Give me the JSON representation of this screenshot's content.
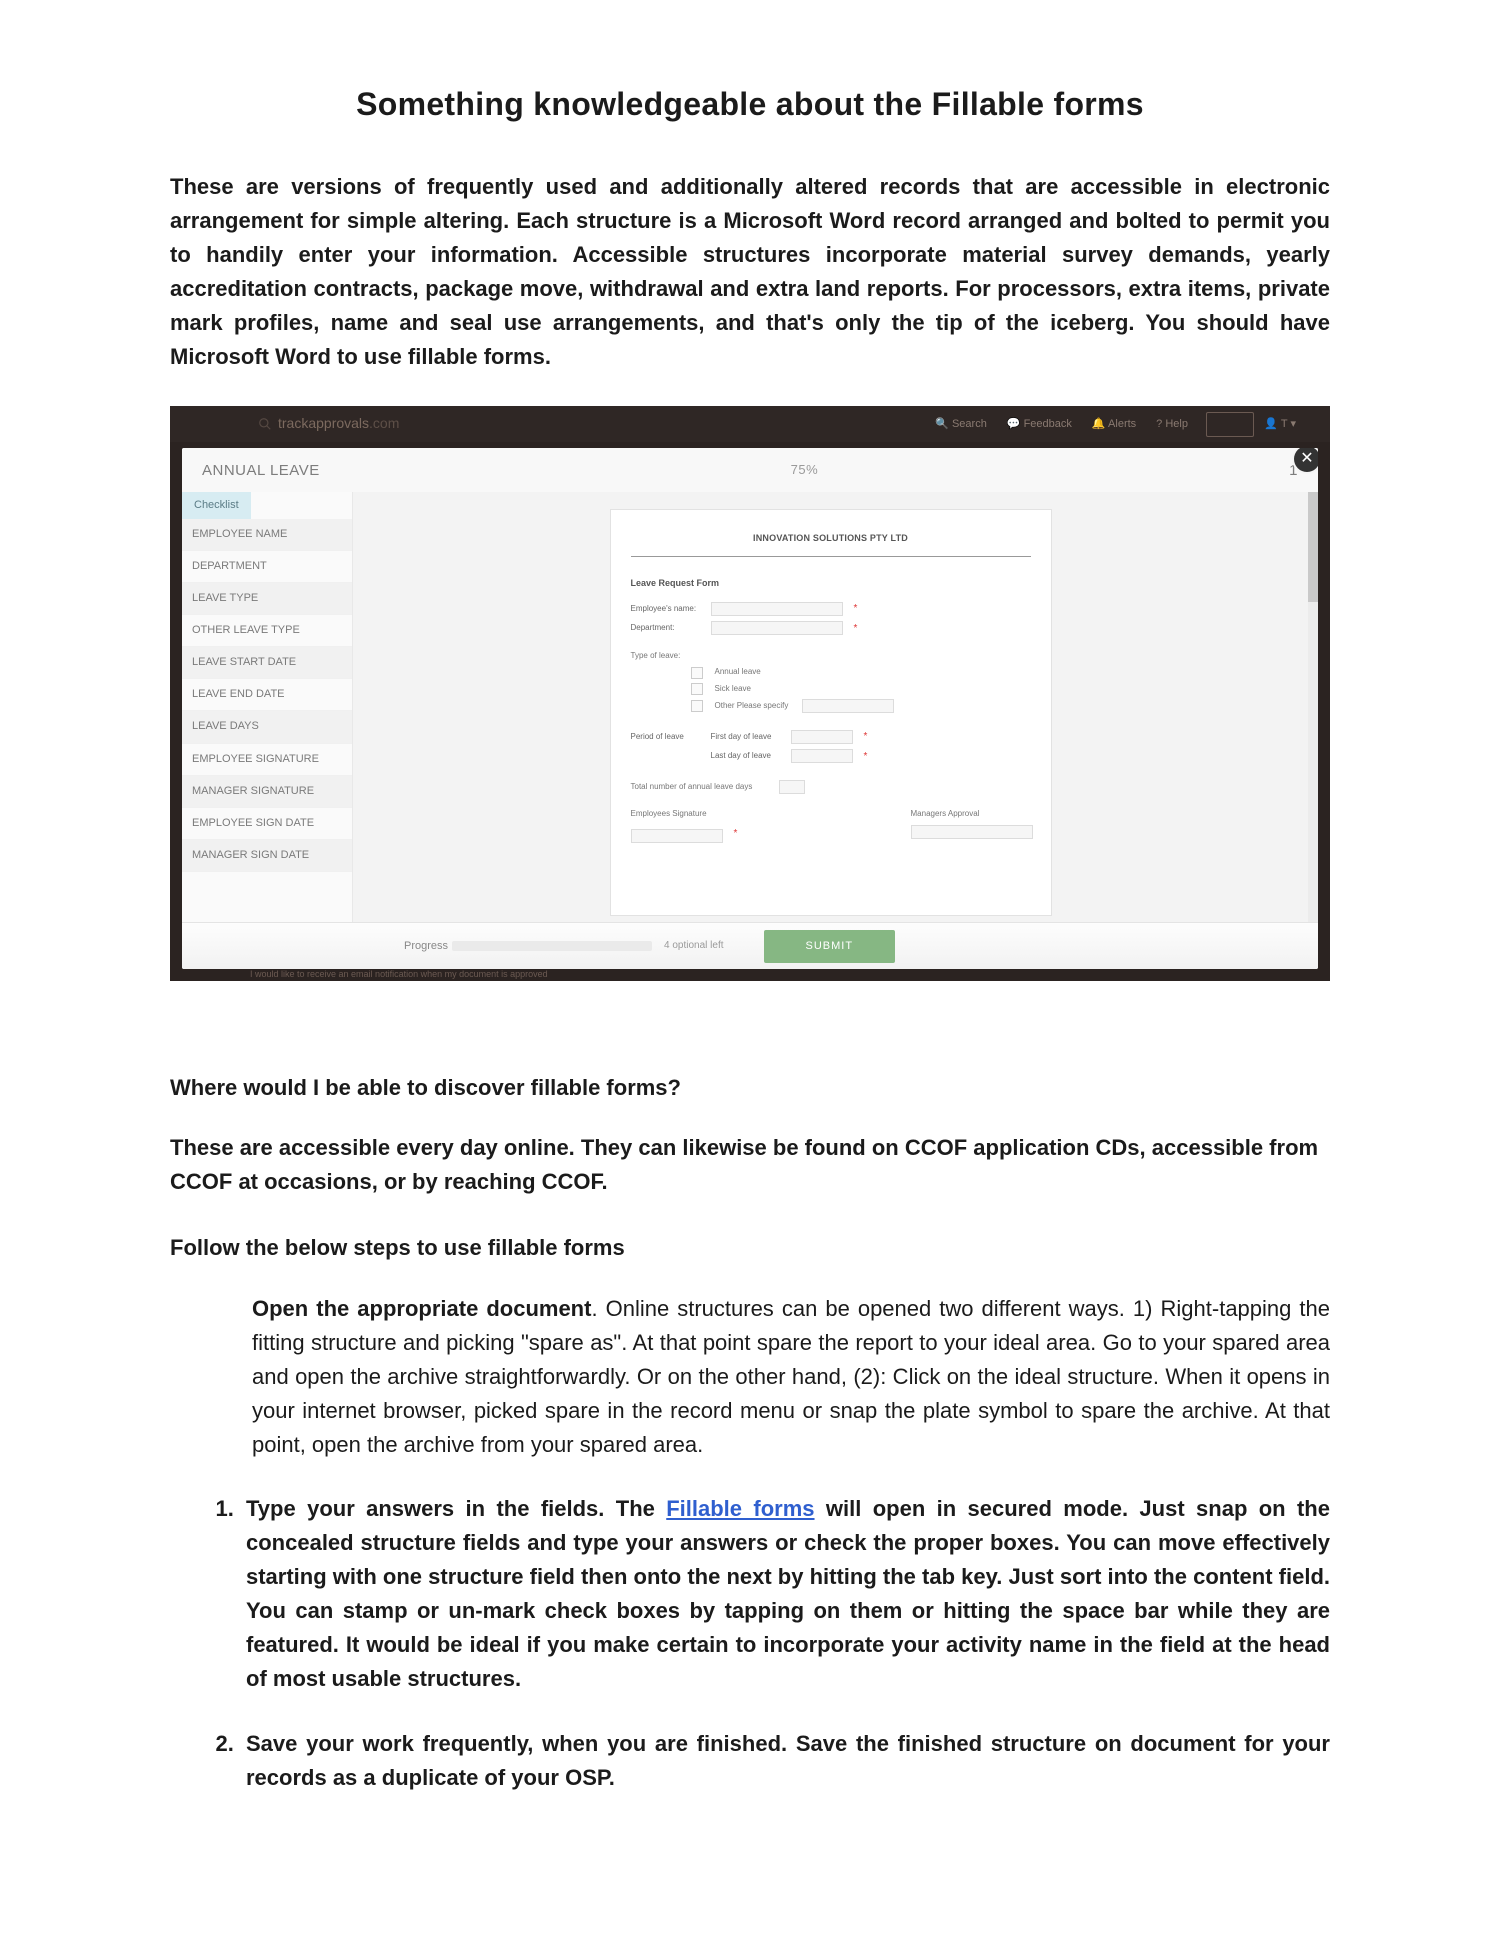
{
  "title": "Something knowledgeable about the Fillable forms",
  "intro": "These are versions of frequently used and additionally altered records that are accessible in electronic arrangement for simple altering. Each structure is a Microsoft Word record arranged and bolted to permit you to handily enter your information. Accessible structures incorporate material survey demands, yearly accreditation contracts, package move, withdrawal and extra land reports. For processors, extra items, private mark profiles, name and seal use arrangements, and that's only the tip of the iceberg. You should have Microsoft Word to use fillable forms.",
  "h_where": "Where would I be able to discover fillable forms?",
  "p_where": "These are accessible every day online. They can likewise be found on CCOF application CDs, accessible from CCOF at occasions, or by reaching CCOF.",
  "h_follow": "Follow the below steps to use fillable forms",
  "step0_strong": "Open the appropriate document",
  "step0_rest": ". Online structures can be opened two different ways. 1) Right-tapping the fitting structure and picking \"spare as\". At that point spare the report to your ideal area. Go to your spared area and open the archive straightforwardly. Or on the other hand, (2): Click on the ideal structure. When it opens in your internet browser, picked spare in the record menu or snap the plate symbol to spare the archive. At that point, open the archive from your spared area.",
  "step1_strong": "Type your answers in the fields.",
  "step1_pre": " The ",
  "step1_link": "Fillable forms",
  "step1_rest": " will open in secured mode. Just snap on the concealed structure fields and type your answers or check the proper boxes. You can move effectively starting with one structure field then onto the next by hitting the tab key. Just sort into the content field. You can stamp or un-mark check boxes by tapping on them or hitting the space bar while they are featured. It would be ideal if you make certain to incorporate your activity name in the field at the head of most usable structures.",
  "step2_strong": "Save your work frequently, when you are finished.",
  "step2_rest": " Save the finished structure on document for your records as a duplicate of your OSP.",
  "mock": {
    "brand": "trackapprovals",
    "brand_suffix": ".com",
    "menu": {
      "search": "Search",
      "feedback": "Feedback",
      "alerts": "Alerts",
      "help": "Help",
      "user": "T"
    },
    "header": {
      "title": "ANNUAL LEAVE",
      "pct": "75%",
      "count": "1"
    },
    "checklist": {
      "tab": "Checklist",
      "items": [
        "EMPLOYEE NAME",
        "DEPARTMENT",
        "LEAVE TYPE",
        "OTHER LEAVE TYPE",
        "LEAVE START DATE",
        "LEAVE END DATE",
        "LEAVE DAYS",
        "EMPLOYEE SIGNATURE",
        "MANAGER SIGNATURE",
        "EMPLOYEE SIGN DATE",
        "MANAGER SIGN DATE"
      ]
    },
    "doc": {
      "company": "INNOVATION SOLUTIONS PTY LTD",
      "form_title": "Leave Request Form",
      "l_empname": "Employee's name:",
      "l_department": "Department:",
      "l_typeleave": "Type of leave:",
      "opt_annual": "Annual leave",
      "opt_sick": "Sick leave",
      "opt_other": "Other   Please specify",
      "l_period": "Period of leave",
      "l_firstday": "First day of leave",
      "l_lastday": "Last day of leave",
      "l_totaldays": "Total number of annual leave days",
      "l_empsig": "Employees Signature",
      "l_mgrsig": "Managers Approval"
    },
    "footer": {
      "progress_label": "Progress",
      "optional": "4 optional left",
      "submit": "SUBMIT"
    }
  }
}
